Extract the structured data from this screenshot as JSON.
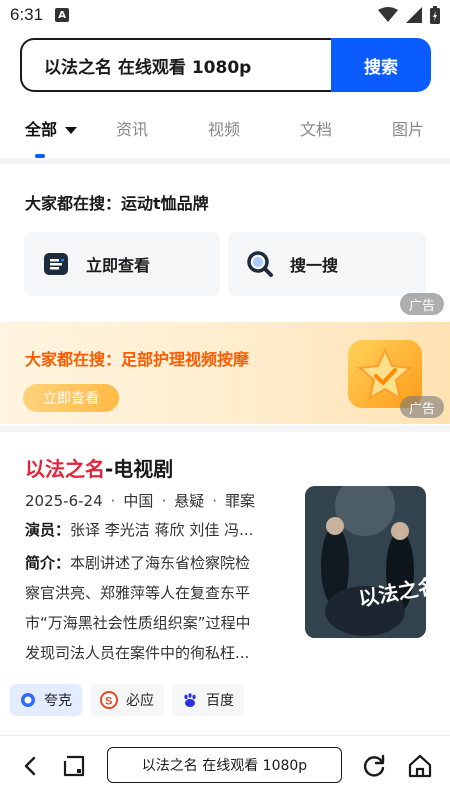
{
  "status_bar": {
    "time": "6:31",
    "notification_badge": "A"
  },
  "search": {
    "query": "以法之名 在线观看 1080p",
    "button_label": "搜索"
  },
  "tabs": [
    {
      "label": "全部",
      "active": true
    },
    {
      "label": "资讯",
      "active": false
    },
    {
      "label": "视频",
      "active": false
    },
    {
      "label": "文档",
      "active": false
    },
    {
      "label": "图片",
      "active": false
    }
  ],
  "hot_search": {
    "title": "大家都在搜：运动t恤品牌",
    "view_now_label": "立即查看",
    "search_label": "搜一搜",
    "ad_label": "广告"
  },
  "banner_ad": {
    "title": "大家都在搜：足部护理视频按摩",
    "button_label": "立即查看",
    "ad_label": "广告"
  },
  "result": {
    "title_highlight": "以法之名",
    "title_rest": "-电视剧",
    "meta": [
      "2025-6-24",
      "中国",
      "悬疑",
      "罪案"
    ],
    "cast_label": "演员：",
    "cast": "张译 李光洁 蒋欣 刘佳 冯...",
    "summary_label": "简介：",
    "summary_lines": [
      "本剧讲述了海东省检察院检",
      "察官洪亮、郑雅萍等人在复查东平",
      "市“万海黑社会性质组织案”过程中",
      "发现司法人员在案件中的徇私枉..."
    ],
    "poster_text": "以法之名"
  },
  "sources": [
    {
      "label": "夸克",
      "icon": "quark-icon",
      "active": true
    },
    {
      "label": "必应",
      "icon": "bing-icon",
      "active": false
    },
    {
      "label": "百度",
      "icon": "baidu-icon",
      "active": false
    }
  ],
  "bottom_bar": {
    "url_text": "以法之名 在线观看 1080p"
  },
  "colors": {
    "accent": "#0a5cff",
    "highlight": "#e4223a",
    "ad_orange": "#ff5a00"
  }
}
